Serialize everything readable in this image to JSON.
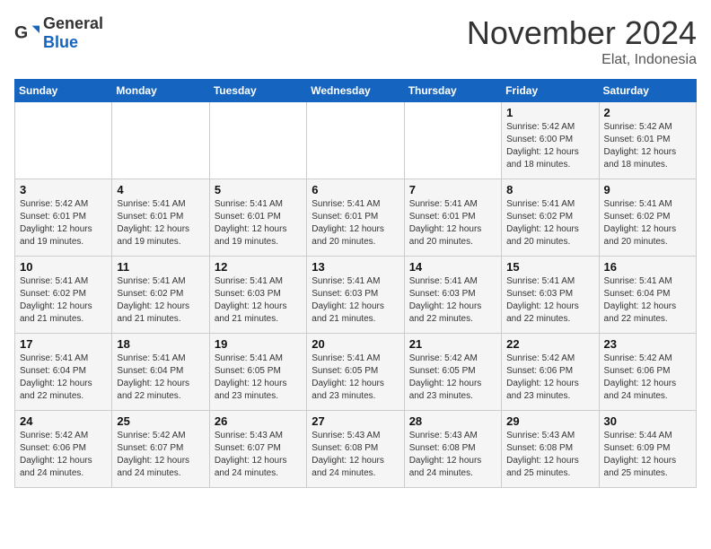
{
  "logo": {
    "text_general": "General",
    "text_blue": "Blue"
  },
  "title": {
    "month": "November 2024",
    "location": "Elat, Indonesia"
  },
  "weekdays": [
    "Sunday",
    "Monday",
    "Tuesday",
    "Wednesday",
    "Thursday",
    "Friday",
    "Saturday"
  ],
  "weeks": [
    [
      {
        "day": "",
        "info": ""
      },
      {
        "day": "",
        "info": ""
      },
      {
        "day": "",
        "info": ""
      },
      {
        "day": "",
        "info": ""
      },
      {
        "day": "",
        "info": ""
      },
      {
        "day": "1",
        "info": "Sunrise: 5:42 AM\nSunset: 6:00 PM\nDaylight: 12 hours and 18 minutes."
      },
      {
        "day": "2",
        "info": "Sunrise: 5:42 AM\nSunset: 6:01 PM\nDaylight: 12 hours and 18 minutes."
      }
    ],
    [
      {
        "day": "3",
        "info": "Sunrise: 5:42 AM\nSunset: 6:01 PM\nDaylight: 12 hours and 19 minutes."
      },
      {
        "day": "4",
        "info": "Sunrise: 5:41 AM\nSunset: 6:01 PM\nDaylight: 12 hours and 19 minutes."
      },
      {
        "day": "5",
        "info": "Sunrise: 5:41 AM\nSunset: 6:01 PM\nDaylight: 12 hours and 19 minutes."
      },
      {
        "day": "6",
        "info": "Sunrise: 5:41 AM\nSunset: 6:01 PM\nDaylight: 12 hours and 20 minutes."
      },
      {
        "day": "7",
        "info": "Sunrise: 5:41 AM\nSunset: 6:01 PM\nDaylight: 12 hours and 20 minutes."
      },
      {
        "day": "8",
        "info": "Sunrise: 5:41 AM\nSunset: 6:02 PM\nDaylight: 12 hours and 20 minutes."
      },
      {
        "day": "9",
        "info": "Sunrise: 5:41 AM\nSunset: 6:02 PM\nDaylight: 12 hours and 20 minutes."
      }
    ],
    [
      {
        "day": "10",
        "info": "Sunrise: 5:41 AM\nSunset: 6:02 PM\nDaylight: 12 hours and 21 minutes."
      },
      {
        "day": "11",
        "info": "Sunrise: 5:41 AM\nSunset: 6:02 PM\nDaylight: 12 hours and 21 minutes."
      },
      {
        "day": "12",
        "info": "Sunrise: 5:41 AM\nSunset: 6:03 PM\nDaylight: 12 hours and 21 minutes."
      },
      {
        "day": "13",
        "info": "Sunrise: 5:41 AM\nSunset: 6:03 PM\nDaylight: 12 hours and 21 minutes."
      },
      {
        "day": "14",
        "info": "Sunrise: 5:41 AM\nSunset: 6:03 PM\nDaylight: 12 hours and 22 minutes."
      },
      {
        "day": "15",
        "info": "Sunrise: 5:41 AM\nSunset: 6:03 PM\nDaylight: 12 hours and 22 minutes."
      },
      {
        "day": "16",
        "info": "Sunrise: 5:41 AM\nSunset: 6:04 PM\nDaylight: 12 hours and 22 minutes."
      }
    ],
    [
      {
        "day": "17",
        "info": "Sunrise: 5:41 AM\nSunset: 6:04 PM\nDaylight: 12 hours and 22 minutes."
      },
      {
        "day": "18",
        "info": "Sunrise: 5:41 AM\nSunset: 6:04 PM\nDaylight: 12 hours and 22 minutes."
      },
      {
        "day": "19",
        "info": "Sunrise: 5:41 AM\nSunset: 6:05 PM\nDaylight: 12 hours and 23 minutes."
      },
      {
        "day": "20",
        "info": "Sunrise: 5:41 AM\nSunset: 6:05 PM\nDaylight: 12 hours and 23 minutes."
      },
      {
        "day": "21",
        "info": "Sunrise: 5:42 AM\nSunset: 6:05 PM\nDaylight: 12 hours and 23 minutes."
      },
      {
        "day": "22",
        "info": "Sunrise: 5:42 AM\nSunset: 6:06 PM\nDaylight: 12 hours and 23 minutes."
      },
      {
        "day": "23",
        "info": "Sunrise: 5:42 AM\nSunset: 6:06 PM\nDaylight: 12 hours and 24 minutes."
      }
    ],
    [
      {
        "day": "24",
        "info": "Sunrise: 5:42 AM\nSunset: 6:06 PM\nDaylight: 12 hours and 24 minutes."
      },
      {
        "day": "25",
        "info": "Sunrise: 5:42 AM\nSunset: 6:07 PM\nDaylight: 12 hours and 24 minutes."
      },
      {
        "day": "26",
        "info": "Sunrise: 5:43 AM\nSunset: 6:07 PM\nDaylight: 12 hours and 24 minutes."
      },
      {
        "day": "27",
        "info": "Sunrise: 5:43 AM\nSunset: 6:08 PM\nDaylight: 12 hours and 24 minutes."
      },
      {
        "day": "28",
        "info": "Sunrise: 5:43 AM\nSunset: 6:08 PM\nDaylight: 12 hours and 24 minutes."
      },
      {
        "day": "29",
        "info": "Sunrise: 5:43 AM\nSunset: 6:08 PM\nDaylight: 12 hours and 25 minutes."
      },
      {
        "day": "30",
        "info": "Sunrise: 5:44 AM\nSunset: 6:09 PM\nDaylight: 12 hours and 25 minutes."
      }
    ]
  ]
}
